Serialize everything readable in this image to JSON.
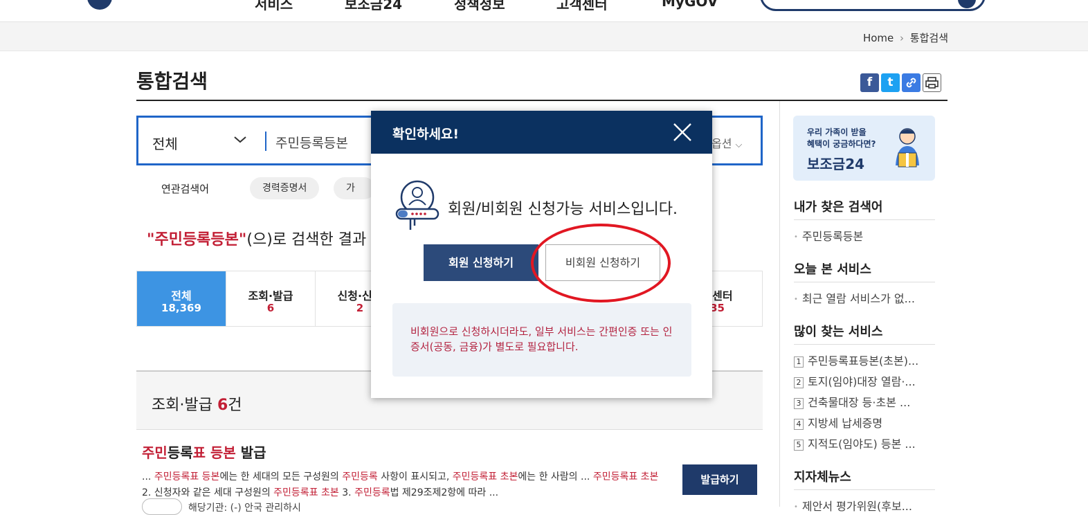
{
  "header": {
    "nav": [
      "서비스",
      "보조금24",
      "정책정보",
      "고객센터",
      "MyGOV"
    ]
  },
  "breadcrumb": {
    "home": "Home",
    "sep": "›",
    "current": "통합검색"
  },
  "page": {
    "title": "통합검색"
  },
  "share": {
    "facebook": "f",
    "twitter": "t",
    "link": "🔗",
    "print": "🖶"
  },
  "search": {
    "category": "전체",
    "query": "주민등록등본",
    "option": "옵션"
  },
  "related": {
    "label": "연관검색어",
    "chips": [
      "경력증명서",
      "가족관계"
    ]
  },
  "result_line": {
    "keyword": "\"주민등록등본\"",
    "suffix": "(으)로 검색한 결과"
  },
  "tabs": [
    {
      "label": "전체",
      "count": "18,369"
    },
    {
      "label": "조회·발급",
      "count": "6"
    },
    {
      "label": "신청·신고",
      "count": "2"
    },
    {
      "label": "콜센터",
      "count": "35"
    }
  ],
  "section": {
    "title": "조회·발급",
    "count": "6",
    "unit": "건"
  },
  "item": {
    "title_a": "주민",
    "title_b": "등록",
    "title_c": "표 등본",
    "title_d": " 발급",
    "desc1": "... ",
    "desc2": "주민등록표 등본",
    "desc3": "에는 한 세대의 모든 구성원의 ",
    "desc4": "주민등록",
    "desc5": " 사항이 표시되고, ",
    "desc6": "주민등록표 초본",
    "desc7": "에는 한 사람의 ... ",
    "desc8": "주민등록표 초본",
    "desc9": " 2. 신청자와 같은 세대 구성원의 ",
    "desc10": "주민등록표 초본",
    "desc11": " 3. ",
    "desc12": "주민등록",
    "desc13": "법 제29조제2항에 따라 ...",
    "button": "발급하기",
    "partial": "해당기관: (-) 안국 관리하시"
  },
  "sidebar": {
    "banner": {
      "line1": "우리 가족이 받을",
      "line2": "혜택이 궁금하다면?",
      "title": "보조금24"
    },
    "my_search": {
      "heading": "내가 찾은 검색어",
      "items": [
        "주민등록등본"
      ]
    },
    "today": {
      "heading": "오늘 본 서비스",
      "items": [
        "최근 열람 서비스가 없..."
      ]
    },
    "popular": {
      "heading": "많이 찾는 서비스",
      "items": [
        {
          "n": "1",
          "t": "주민등록표등본(초본)..."
        },
        {
          "n": "2",
          "t": "토지(임야)대장 열람·..."
        },
        {
          "n": "3",
          "t": "건축물대장 등·초본 ..."
        },
        {
          "n": "4",
          "t": "지방세 납세증명"
        },
        {
          "n": "5",
          "t": "지적도(임야도) 등본 ..."
        }
      ]
    },
    "news": {
      "heading": "지자체뉴스",
      "items": [
        "제안서 평가위원(후보..."
      ]
    }
  },
  "modal": {
    "title": "확인하세요!",
    "message": "회원/비회원 신청가능 서비스입니다.",
    "member_button": "회원 신청하기",
    "nonmember_button": "비회원 신청하기",
    "note": "비회원으로 신청하시더라도, 일부 서비스는 간편인증 또는 인증서(공동, 금융)가 별도로 필요합니다."
  },
  "colors": {
    "navy": "#0b3160",
    "accent": "#c21f35",
    "tab_active": "#3d94e3",
    "annotation": "#e11722"
  }
}
